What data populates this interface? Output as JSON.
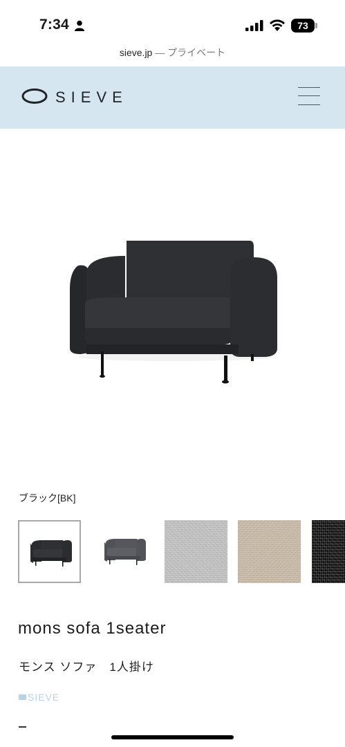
{
  "status_bar": {
    "time": "7:34",
    "battery": "73",
    "icons": [
      "person-icon",
      "signal-icon",
      "wifi-icon",
      "battery-icon"
    ]
  },
  "browser": {
    "domain": "sieve.jp",
    "separator": "—",
    "mode": "プライベート"
  },
  "header": {
    "logo_text": "SIEVE",
    "background_color": "#d5e6f1",
    "menu_icon": "hamburger-menu-icon"
  },
  "product": {
    "color_label": "ブラック[BK]",
    "name": "mons sofa 1seater",
    "name_jp": "モンス ソファ　1人掛け",
    "brand_tag": "SIEVE",
    "extra": "–"
  },
  "swatches": [
    {
      "kind": "thumbnail",
      "name": "black",
      "selected": true
    },
    {
      "kind": "thumbnail",
      "name": "dark-gray",
      "selected": false
    },
    {
      "kind": "fabric",
      "name": "light-gray",
      "color": "#c7c7c7",
      "selected": false
    },
    {
      "kind": "fabric",
      "name": "beige",
      "color": "#cbbfae",
      "selected": false
    },
    {
      "kind": "fabric",
      "name": "black-tweed",
      "color": "#111111",
      "selected": false
    }
  ],
  "colors": {
    "accent": "#d5e6f1",
    "brand_tag": "#b8d2e6",
    "text": "#1a1a1a"
  }
}
